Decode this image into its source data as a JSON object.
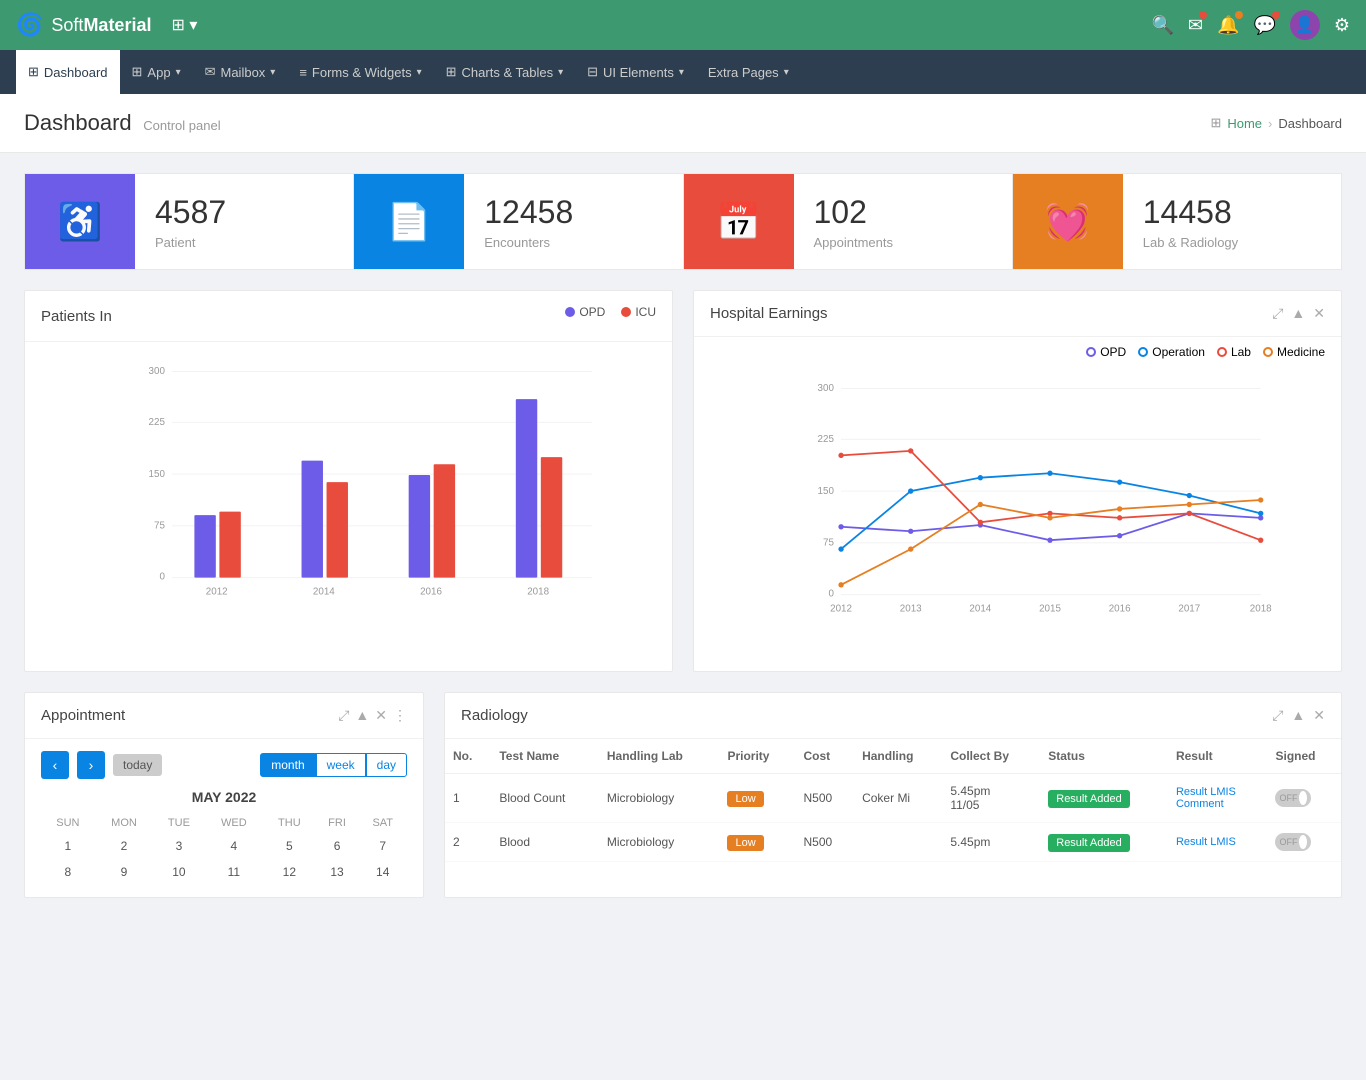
{
  "brand": {
    "name_soft": "Soft",
    "name_material": "Material",
    "logo": "♻"
  },
  "topnav": {
    "icons": [
      "search",
      "mail",
      "bell",
      "chat",
      "avatar",
      "settings"
    ]
  },
  "mainnav": {
    "items": [
      {
        "label": "Dashboard",
        "icon": "⊞",
        "active": true
      },
      {
        "label": "App",
        "icon": "⊞",
        "dropdown": true
      },
      {
        "label": "Mailbox",
        "icon": "✉",
        "dropdown": true
      },
      {
        "label": "Forms & Widgets",
        "icon": "≡",
        "dropdown": true
      },
      {
        "label": "Charts & Tables",
        "icon": "⊞",
        "dropdown": true
      },
      {
        "label": "UI Elements",
        "icon": "⊟",
        "dropdown": true
      },
      {
        "label": "Extra Pages",
        "icon": "",
        "dropdown": true
      }
    ]
  },
  "breadcrumb": {
    "page_title": "Dashboard",
    "subtitle": "Control panel",
    "home": "Home",
    "current": "Dashboard"
  },
  "stats": [
    {
      "icon": "♿",
      "color": "purple",
      "number": "4587",
      "label": "Patient"
    },
    {
      "icon": "📄",
      "color": "blue",
      "number": "12458",
      "label": "Encounters"
    },
    {
      "icon": "📅",
      "color": "red",
      "number": "102",
      "label": "Appointments"
    },
    {
      "icon": "💓",
      "color": "orange",
      "number": "14458",
      "label": "Lab & Radiology"
    }
  ],
  "patients_chart": {
    "title": "Patients In",
    "legend": [
      {
        "label": "OPD",
        "color": "#6c5ce7"
      },
      {
        "label": "ICU",
        "color": "#e74c3c"
      }
    ],
    "years": [
      "2012",
      "2014",
      "2016",
      "2018"
    ],
    "opd": [
      85,
      160,
      140,
      245
    ],
    "icu": [
      90,
      130,
      155,
      165
    ]
  },
  "earnings_chart": {
    "title": "Hospital Earnings",
    "legend": [
      {
        "label": "OPD",
        "color": "#6c5ce7"
      },
      {
        "label": "Operation",
        "color": "#0984e3"
      },
      {
        "label": "Lab",
        "color": "#e74c3c"
      },
      {
        "label": "Medicine",
        "color": "#e67e22"
      }
    ],
    "years": [
      "2012",
      "2013",
      "2014",
      "2015",
      "2016",
      "2017",
      "2018"
    ]
  },
  "appointment": {
    "title": "Appointment",
    "month_title": "MAY 2022",
    "days_header": [
      "SUN",
      "MON",
      "TUE",
      "WED",
      "THU",
      "FRI",
      "SAT"
    ],
    "weeks": [
      [
        {
          "d": "1",
          "o": false
        },
        {
          "d": "2",
          "o": false
        },
        {
          "d": "3",
          "o": false
        },
        {
          "d": "4",
          "o": false
        },
        {
          "d": "5",
          "o": false
        },
        {
          "d": "6",
          "o": false
        },
        {
          "d": "7",
          "o": false
        }
      ],
      [
        {
          "d": "8",
          "o": false
        },
        {
          "d": "9",
          "o": false
        },
        {
          "d": "10",
          "o": false
        },
        {
          "d": "11",
          "o": false
        },
        {
          "d": "12",
          "o": false
        },
        {
          "d": "13",
          "o": false
        },
        {
          "d": "14",
          "o": false
        }
      ]
    ],
    "view_btns": [
      "month",
      "week",
      "day"
    ],
    "active_view": "month"
  },
  "radiology": {
    "title": "Radiology",
    "columns": [
      "No.",
      "Test Name",
      "Handling Lab",
      "Priority",
      "Cost",
      "Handling",
      "Collect By",
      "Status",
      "Result",
      "Signed"
    ],
    "rows": [
      {
        "no": "1",
        "test_name": "Blood Count",
        "handling_lab": "Microbiology",
        "priority": "Low",
        "cost": "N500",
        "handling": "Coker Mi",
        "collect_by": "5.45pm 11/05",
        "status": "Result Added",
        "result_link": "Result LMIS",
        "comment_link": "Comment",
        "signed": "OFF"
      },
      {
        "no": "2",
        "test_name": "Blood",
        "handling_lab": "Microbiology",
        "priority": "Low",
        "cost": "N500",
        "handling": "",
        "collect_by": "5.45pm",
        "status": "Result Added",
        "result_link": "Result LMIS",
        "comment_link": "",
        "signed": "OFF"
      }
    ]
  }
}
